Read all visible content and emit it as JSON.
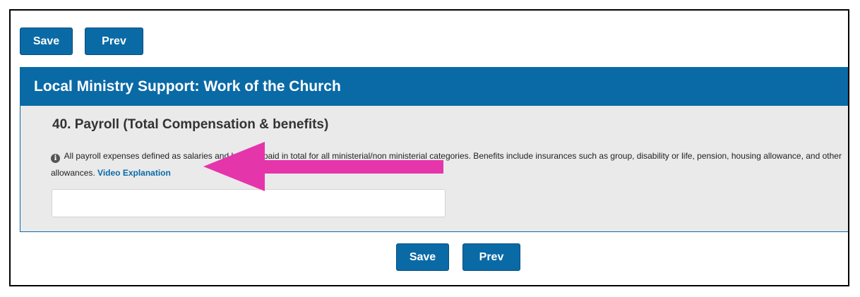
{
  "toolbar": {
    "save_label": "Save",
    "prev_label": "Prev"
  },
  "section": {
    "title": "Local Ministry Support: Work of the Church"
  },
  "question": {
    "title": "40. Payroll (Total Compensation & benefits)",
    "info_text": "All payroll expenses defined as salaries and benefits paid in total for all ministerial/non ministerial categories. Benefits include insurances such as group, disability or life, pension, housing allowance, and other allowances.",
    "link_label": "Video Explanation",
    "input_value": "",
    "info_icon": "info-icon"
  },
  "footer": {
    "save_label": "Save",
    "prev_label": "Prev"
  },
  "annotation": {
    "arrow_icon": "arrow-left-icon",
    "arrow_color": "#e535ab"
  },
  "colors": {
    "primary": "#0a6aa6",
    "panel_bg": "#eaeaea"
  }
}
